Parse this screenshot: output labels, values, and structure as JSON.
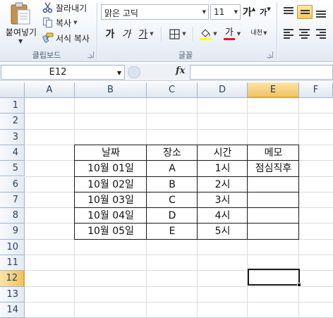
{
  "ribbon": {
    "clipboard": {
      "paste_label": "붙여넣기",
      "cut_label": "잘라내기",
      "copy_label": "복사",
      "format_painter_label": "서식 복사",
      "group_label": "클립보드"
    },
    "font": {
      "font_name": "맑은 고딕",
      "font_size": "11",
      "grow_font": "가",
      "shrink_font": "가",
      "bold": "가",
      "italic": "가",
      "underline": "가",
      "font_color_glyph": "가",
      "phonetic_glyph": "내천",
      "group_label": "글꼴",
      "fill_color": "#ffff00",
      "font_color": "#e81123"
    }
  },
  "formula_bar": {
    "name_box": "E12",
    "fx": "fx",
    "formula": ""
  },
  "sheet": {
    "columns": [
      "A",
      "B",
      "C",
      "D",
      "E",
      "F"
    ],
    "rows": [
      "1",
      "2",
      "3",
      "4",
      "5",
      "6",
      "7",
      "8",
      "9",
      "10",
      "11",
      "12",
      "13",
      "14"
    ],
    "selected_cell": "E12",
    "table": {
      "headers": [
        "날짜",
        "장소",
        "시간",
        "메모"
      ],
      "rows": [
        [
          "10월 01일",
          "A",
          "1시",
          "점심직후"
        ],
        [
          "10월 02일",
          "B",
          "2시",
          ""
        ],
        [
          "10월 03일",
          "C",
          "3시",
          ""
        ],
        [
          "10월 04일",
          "D",
          "4시",
          ""
        ],
        [
          "10월 05일",
          "E",
          "5시",
          ""
        ]
      ]
    }
  }
}
